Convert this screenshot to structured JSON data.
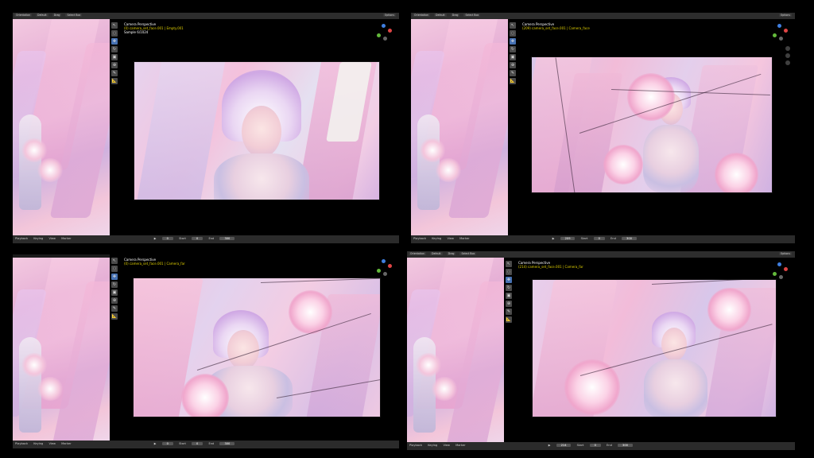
{
  "header": {
    "orientation_label": "Orientation",
    "orientation_value": "Default",
    "drag_label": "Drag",
    "select_box": "Select Box",
    "options": "Options"
  },
  "footer": {
    "playback": "Playback",
    "keying": "Keying",
    "view": "View",
    "marker": "Marker",
    "start_label": "Start",
    "start_value": "0",
    "end_label": "End",
    "end_value": "300"
  },
  "panels": [
    {
      "title": "Camera Perspective",
      "subtitle": "(0) camera_set_face.001 | Empty.001",
      "sample": "Sample 6/1024",
      "current_frame": "0"
    },
    {
      "title": "Camera Perspective",
      "subtitle": "(209) camera_set_face.001 | Camera_face",
      "sample": "",
      "current_frame": "209"
    },
    {
      "title": "Camera Perspective",
      "subtitle": "(0) camera_set_face.001 | Camera_far",
      "sample": "",
      "current_frame": "0"
    },
    {
      "title": "Camera Perspective",
      "subtitle": "(214) camera_set_face.001 | Camera_far",
      "sample": "",
      "current_frame": "214"
    }
  ],
  "colors": {
    "accent": "#4772b3",
    "hud_subtitle": "#e0d000",
    "axis_x": "#e04545",
    "axis_y": "#63b93b",
    "axis_z": "#3f7fe0"
  },
  "icons": [
    "cursor-icon",
    "move-icon",
    "rotate-icon",
    "scale-icon",
    "transform-icon",
    "annotate-icon",
    "measure-icon",
    "zoom-icon",
    "hand-icon",
    "camera-icon",
    "play-icon"
  ]
}
